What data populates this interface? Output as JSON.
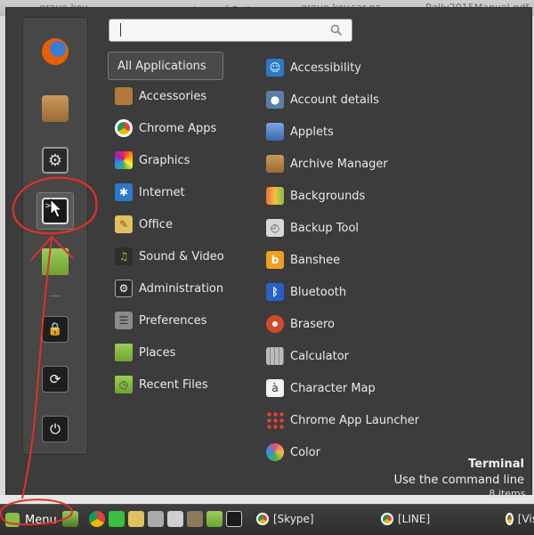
{
  "desktop_labels": [
    "grave-key",
    "สรุปสอบเพย์ Rails",
    "grave-key.sar.gz",
    "Rally2015Manual.pdf"
  ],
  "search": {
    "placeholder": ""
  },
  "favorites": [
    {
      "name": "firefox-icon",
      "color": "#e66000"
    },
    {
      "name": "package-icon",
      "color": "#b07a3c"
    },
    {
      "name": "settings-icon",
      "color": "#555555"
    },
    {
      "name": "terminal-icon",
      "color": "#1d1d1d"
    },
    {
      "name": "folder-icon",
      "color": "#7fb13b"
    },
    {
      "name": "lock-icon",
      "color": "#222222"
    },
    {
      "name": "logout-icon",
      "color": "#222222"
    },
    {
      "name": "power-icon",
      "color": "#222222"
    }
  ],
  "categories": [
    {
      "label": "All Applications",
      "icon": "none"
    },
    {
      "label": "Accessories",
      "icon": "accessories-icon",
      "color": "#b07a3c"
    },
    {
      "label": "Chrome Apps",
      "icon": "chrome-icon",
      "color": "#db4437"
    },
    {
      "label": "Graphics",
      "icon": "graphics-icon",
      "color": "#e91e63"
    },
    {
      "label": "Internet",
      "icon": "internet-icon",
      "color": "#2a7ac8"
    },
    {
      "label": "Office",
      "icon": "office-icon",
      "color": "#c8a23a"
    },
    {
      "label": "Sound & Video",
      "icon": "media-icon",
      "color": "#3a8a3a"
    },
    {
      "label": "Administration",
      "icon": "admin-icon",
      "color": "#777777"
    },
    {
      "label": "Preferences",
      "icon": "preferences-icon",
      "color": "#888888"
    },
    {
      "label": "Places",
      "icon": "places-icon",
      "color": "#7fb13b"
    },
    {
      "label": "Recent Files",
      "icon": "recent-icon",
      "color": "#7fb13b"
    }
  ],
  "apps": [
    {
      "label": "Accessibility",
      "icon": "accessibility-icon",
      "color": "#2a7ac8",
      "glyph": "♿"
    },
    {
      "label": "Account details",
      "icon": "account-icon",
      "color": "#5a7ea8",
      "glyph": "👤"
    },
    {
      "label": "Applets",
      "icon": "applets-icon",
      "color": "#4a78b8",
      "glyph": ""
    },
    {
      "label": "Archive Manager",
      "icon": "archive-icon",
      "color": "#b07a3c",
      "glyph": ""
    },
    {
      "label": "Backgrounds",
      "icon": "backgrounds-icon",
      "color": "#e0823a",
      "glyph": ""
    },
    {
      "label": "Backup Tool",
      "icon": "backup-icon",
      "color": "#cccccc",
      "glyph": ""
    },
    {
      "label": "Banshee",
      "icon": "banshee-icon",
      "color": "#f0a020",
      "glyph": "b"
    },
    {
      "label": "Bluetooth",
      "icon": "bluetooth-icon",
      "color": "#2a5fc8",
      "glyph": "ᛒ"
    },
    {
      "label": "Brasero",
      "icon": "brasero-icon",
      "color": "#d04a2a",
      "glyph": "●"
    },
    {
      "label": "Calculator",
      "icon": "calculator-icon",
      "color": "#aaaaaa",
      "glyph": ""
    },
    {
      "label": "Character Map",
      "icon": "charmap-icon",
      "color": "#eeeeee",
      "glyph": "à"
    },
    {
      "label": "Chrome App Launcher",
      "icon": "chrome-launcher-icon",
      "color": "#444444",
      "glyph": ""
    },
    {
      "label": "Color",
      "icon": "color-icon",
      "color": "#e94e77",
      "glyph": ""
    }
  ],
  "description": {
    "title": "Terminal",
    "text": "Use the command line"
  },
  "counter": "8 items,",
  "taskbar": {
    "menu_label": "Menu",
    "windows": [
      "[Skype]",
      "[LINE]",
      "[Vis"
    ]
  },
  "colors": {
    "menu_bg": "#3c3c3c",
    "accent_mint": "#86be43",
    "annotation_red": "#e0302a"
  }
}
